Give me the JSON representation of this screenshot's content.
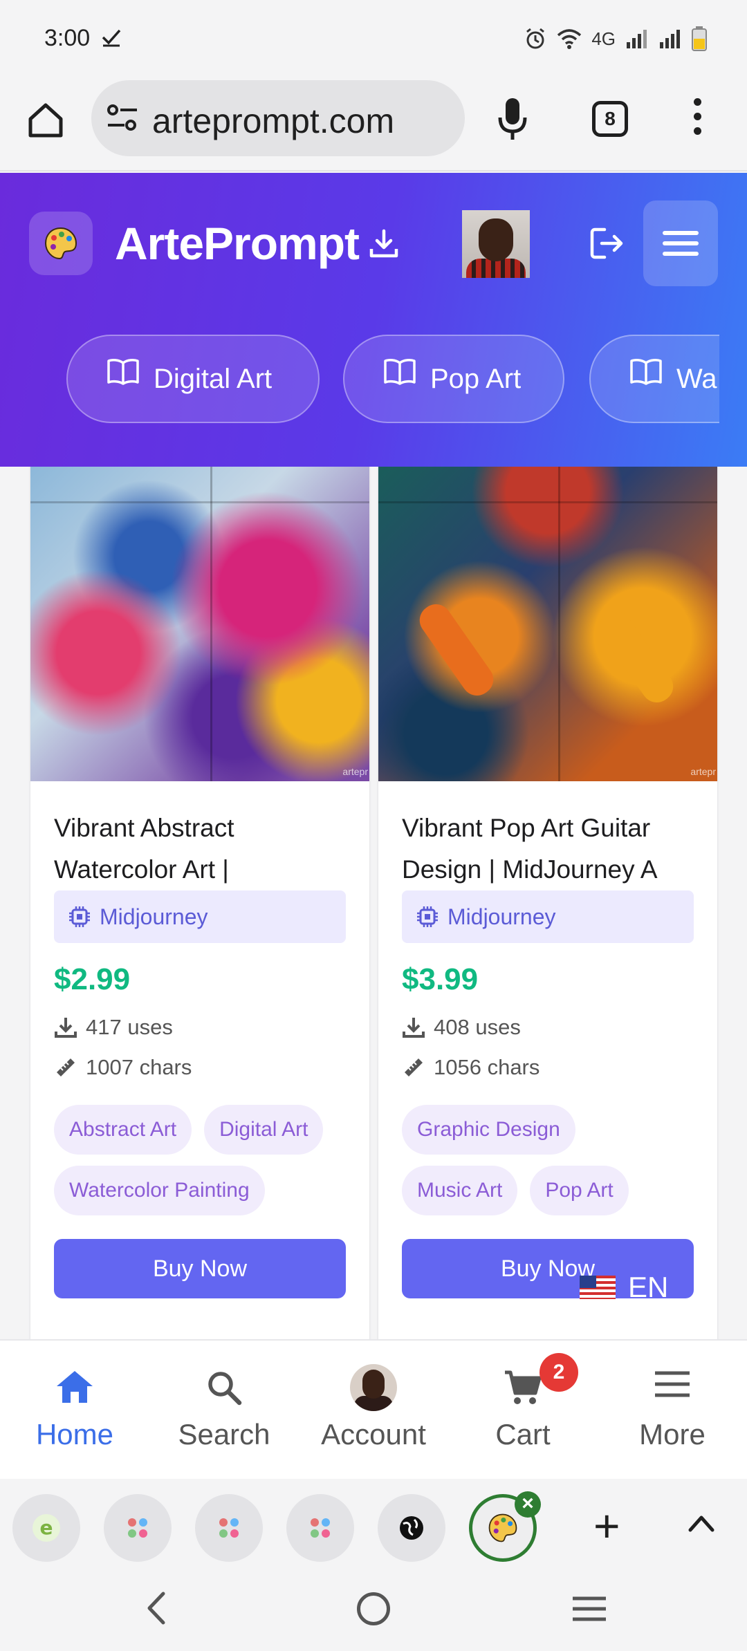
{
  "status_bar": {
    "time": "3:00",
    "network": "4G"
  },
  "browser": {
    "url": "arteprompt.com",
    "tab_count": "8"
  },
  "site": {
    "brand": "ArtePrompt",
    "categories": [
      {
        "label": "Digital Art",
        "icon": "book-icon"
      },
      {
        "label": "Pop Art",
        "icon": "book-icon"
      },
      {
        "label": "Wa",
        "icon": "book-icon"
      }
    ]
  },
  "products": [
    {
      "title": "Vibrant Abstract Watercolor Art |",
      "model": "Midjourney",
      "price": "$2.99",
      "uses": "417 uses",
      "chars": "1007 chars",
      "tags": [
        "Abstract Art",
        "Digital Art",
        "Watercolor Painting"
      ],
      "button": "Buy Now",
      "watermark": "artepr"
    },
    {
      "title": "Vibrant Pop Art Guitar Design | MidJourney A",
      "model": "Midjourney",
      "price": "$3.99",
      "uses": "408 uses",
      "chars": "1056 chars",
      "tags": [
        "Graphic Design",
        "Music Art",
        "Pop Art"
      ],
      "button": "Buy Now",
      "watermark": "artepr"
    }
  ],
  "language": "EN",
  "bottom_nav": {
    "items": [
      {
        "label": "Home",
        "icon": "home-icon"
      },
      {
        "label": "Search",
        "icon": "search-icon"
      },
      {
        "label": "Account",
        "icon": "avatar"
      },
      {
        "label": "Cart",
        "icon": "cart-icon"
      },
      {
        "label": "More",
        "icon": "menu-icon"
      }
    ],
    "cart_count": "2"
  },
  "colors": {
    "header_start": "#6a2bdc",
    "header_end": "#3b7cf5",
    "price": "#10b981",
    "button": "#6366f1",
    "active_nav": "#3b6ee8"
  }
}
